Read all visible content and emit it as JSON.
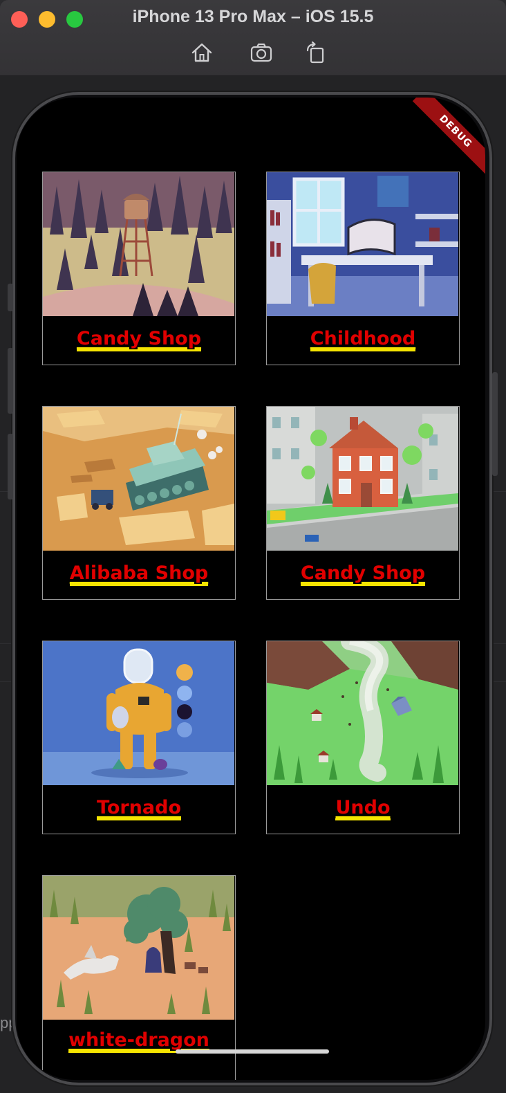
{
  "window": {
    "title": "iPhone 13 Pro Max – iOS 15.5",
    "toolbar": [
      "home-icon",
      "screenshot-icon",
      "rotate-icon"
    ]
  },
  "app": {
    "debug_banner": "DEBUG",
    "cards": [
      {
        "label": "Candy Shop"
      },
      {
        "label": "Childhood"
      },
      {
        "label": "Alibaba Shop"
      },
      {
        "label": "Candy Shop"
      },
      {
        "label": "Tornado"
      },
      {
        "label": "Undo"
      },
      {
        "label": "white-dragon"
      }
    ]
  },
  "background_text": "pp",
  "colors": {
    "label_text": "#e10000",
    "label_underline": "#f5e400",
    "screen_bg": "#000000",
    "card_border": "#9a9a9a"
  }
}
